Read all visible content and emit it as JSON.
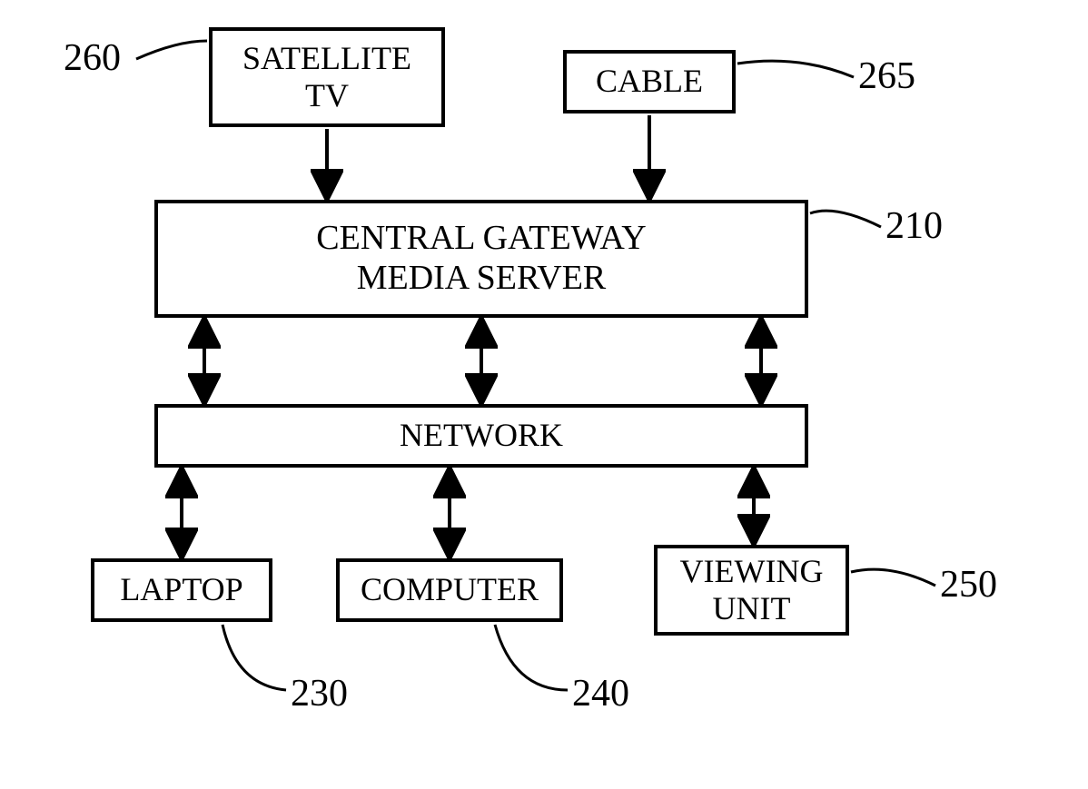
{
  "blocks": {
    "satellite": {
      "label": "SATELLITE\nTV",
      "ref": "260"
    },
    "cable": {
      "label": "CABLE",
      "ref": "265"
    },
    "gateway": {
      "label": "CENTRAL GATEWAY\nMEDIA SERVER",
      "ref": "210"
    },
    "network": {
      "label": "NETWORK"
    },
    "laptop": {
      "label": "LAPTOP",
      "ref": "230"
    },
    "computer": {
      "label": "COMPUTER",
      "ref": "240"
    },
    "viewing": {
      "label": "VIEWING\nUNIT",
      "ref": "250"
    }
  }
}
